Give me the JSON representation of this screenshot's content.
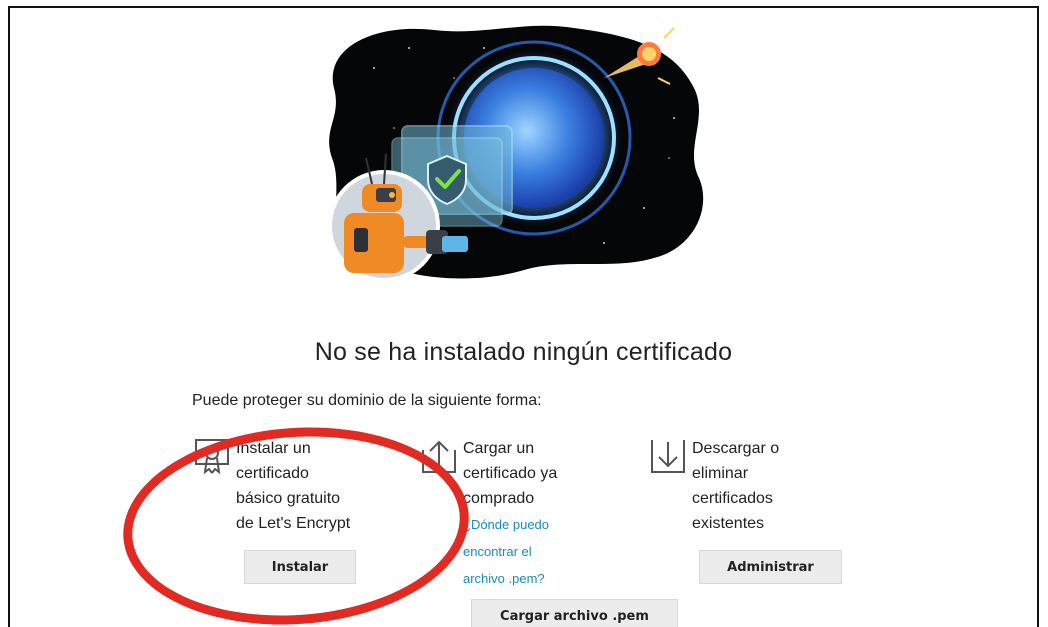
{
  "empty_state": {
    "title": "No se ha instalado ningún certificado",
    "intro": "Puede proteger su dominio de la siguiente forma:"
  },
  "options": [
    {
      "icon": "certificate-icon",
      "lines": [
        "Instalar un",
        "certificado",
        "básico gratuito",
        "de Let's Encrypt"
      ],
      "button": "Instalar"
    },
    {
      "icon": "upload-icon",
      "lines": [
        "Cargar un",
        "certificado ya",
        "comprado"
      ],
      "link_lines": [
        "¿Dónde puedo",
        "encontrar el",
        "archivo .pem?"
      ],
      "button": "Cargar archivo .pem"
    },
    {
      "icon": "download-icon",
      "lines": [
        "Descargar o",
        "eliminar",
        "certificados",
        "existentes"
      ],
      "button": "Administrar"
    }
  ],
  "colors": {
    "link": "#1a8bb8",
    "highlight": "#e02a22",
    "button_bg": "#ececec"
  }
}
